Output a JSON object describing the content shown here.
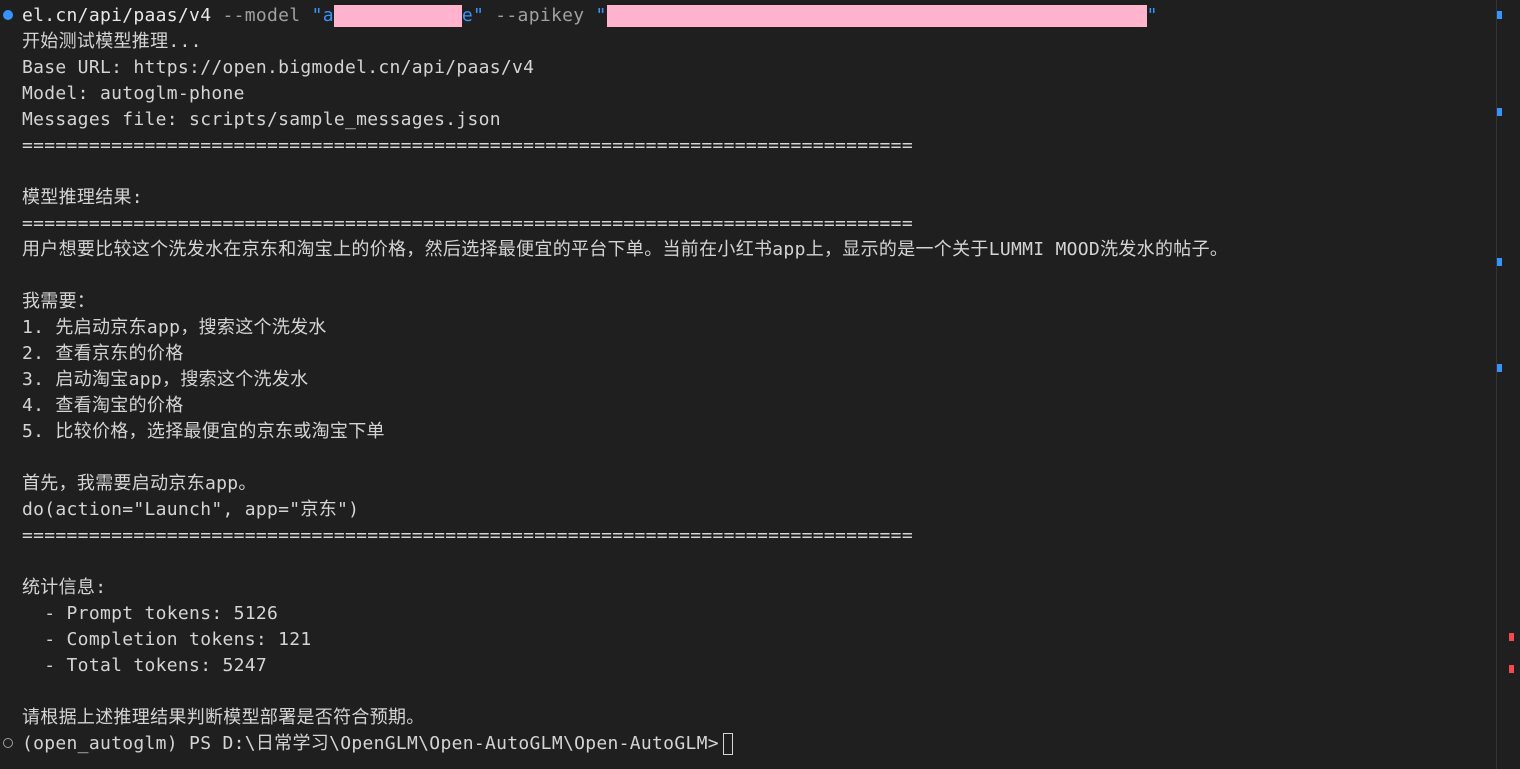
{
  "terminal": {
    "command": {
      "prefix": "el.cn/api/paas/v4",
      "model_flag": "--model",
      "model_open": "\"a",
      "model_close": "e\"",
      "apikey_flag": "--apikey",
      "apikey_open": "\"",
      "apikey_close": "\""
    },
    "lines": {
      "start": "开始测试模型推理...",
      "base_url": "Base URL: https://open.bigmodel.cn/api/paas/v4",
      "model": "Model: autoglm-phone",
      "messages_file": "Messages file: scripts/sample_messages.json",
      "separator": "================================================================================",
      "result_heading": "模型推理结果:",
      "summary": "用户想要比较这个洗发水在京东和淘宝上的价格，然后选择最便宜的平台下单。当前在小红书app上，显示的是一个关于LUMMI MOOD洗发水的帖子。",
      "need": "我需要：",
      "step1": "1. 先启动京东app，搜索这个洗发水",
      "step2": "2. 查看京东的价格",
      "step3": "3. 启动淘宝app，搜索这个洗发水",
      "step4": "4. 查看淘宝的价格",
      "step5": "5. 比较价格，选择最便宜的京东或淘宝下单",
      "first": "首先，我需要启动京东app。",
      "action": "do(action=\"Launch\", app=\"京东\")",
      "stats_heading": "统计信息:",
      "prompt_tokens": "  - Prompt tokens: 5126",
      "completion_tokens": "  - Completion tokens: 121",
      "total_tokens": "  - Total tokens: 5247",
      "judge": "请根据上述推理结果判断模型部署是否符合预期。",
      "prompt": "(open_autoglm) PS D:\\日常学习\\OpenGLM\\Open-AutoGLM\\Open-AutoGLM>"
    }
  },
  "colors": {
    "background": "#1f1f1f",
    "text": "#d4d4d4",
    "accent_blue": "#3794ff",
    "redaction": "#ffb3cc",
    "error_red": "#f14c4c"
  },
  "icons": {
    "gutter_success": "filled-circle",
    "gutter_prompt": "hollow-circle"
  }
}
